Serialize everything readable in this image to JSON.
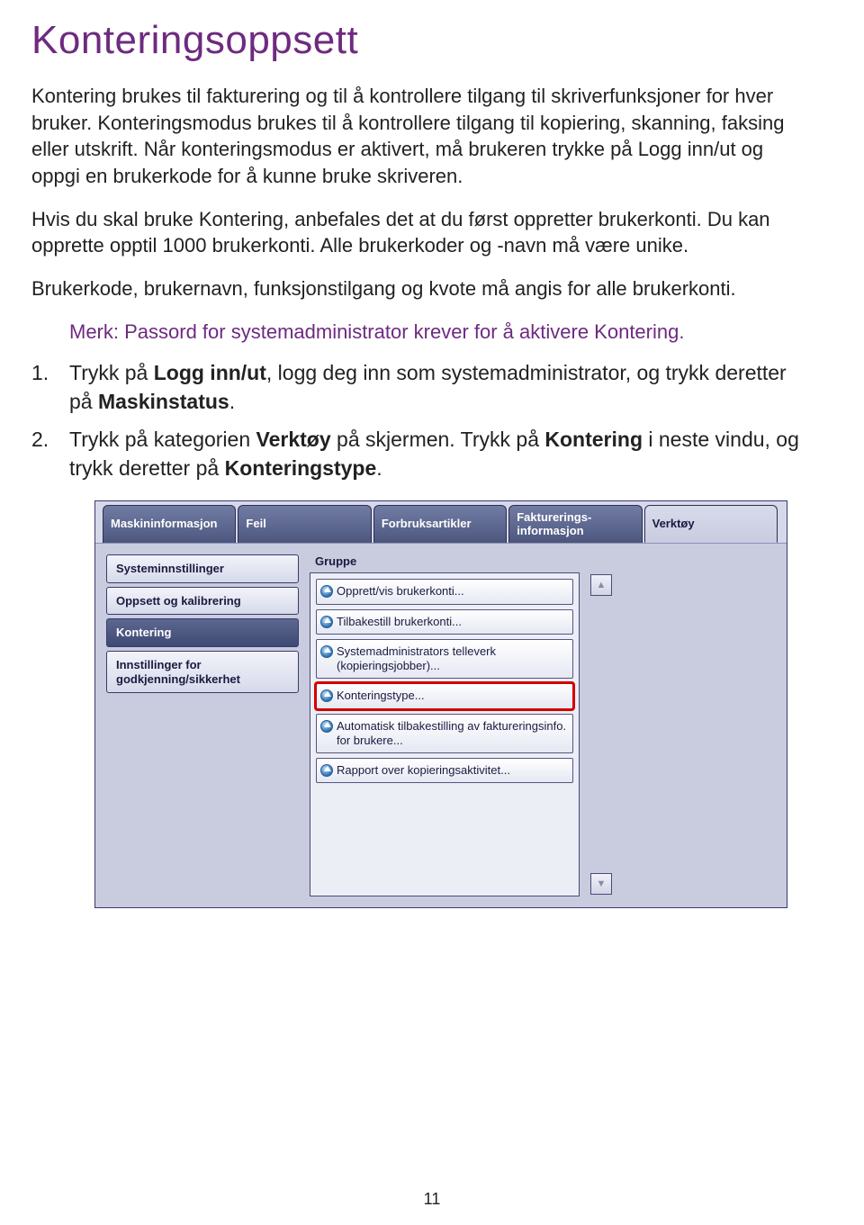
{
  "heading": "Konteringsoppsett",
  "para1": "Kontering brukes til fakturering og til å kontrollere tilgang til skriverfunksjoner for hver bruker. Konteringsmodus brukes til å kontrollere tilgang til kopiering, skanning, faksing eller utskrift. Når konteringsmodus er aktivert, må brukeren trykke på Logg inn/ut og oppgi en brukerkode for å kunne bruke skriveren.",
  "para2": "Hvis du skal bruke Kontering, anbefales det at du først oppretter brukerkonti. Du kan opprette opptil 1000 brukerkonti. Alle brukerkoder og -navn må være unike.",
  "para3": "Brukerkode, brukernavn, funksjonstilgang og kvote må angis for alle brukerkonti.",
  "note": "Merk: Passord for systemadministrator krever for å aktivere Kontering.",
  "step1_num": "1.",
  "step1_a": "Trykk på ",
  "step1_b": "Logg inn/ut",
  "step1_c": ", logg deg inn som systemadministrator, og trykk deretter på ",
  "step1_d": "Maskinstatus",
  "step1_e": ".",
  "step2_num": "2.",
  "step2_a": "Trykk på kategorien ",
  "step2_b": "Verktøy",
  "step2_c": " på skjermen. Trykk på ",
  "step2_d": "Kontering",
  "step2_e": " i neste vindu, og trykk deretter på ",
  "step2_f": "Konteringstype",
  "step2_g": ".",
  "tabs": {
    "t0": "Maskininformasjon",
    "t1": "Feil",
    "t2": "Forbruksartikler",
    "t3": "Fakturerings-\ninformasjon",
    "t4": "Verktøy"
  },
  "sidebar": {
    "s0": "Systeminnstillinger",
    "s1": "Oppsett og kalibrering",
    "s2": "Kontering",
    "s3": "Innstillinger for godkjenning/sikkerhet"
  },
  "groupTitle": "Gruppe",
  "items": {
    "i0": "Opprett/vis brukerkonti...",
    "i1": "Tilbakestill brukerkonti...",
    "i2": "Systemadministrators telleverk (kopieringsjobber)...",
    "i3": "Konteringstype...",
    "i4": "Automatisk tilbakestilling av faktureringsinfo. for brukere...",
    "i5": "Rapport over kopieringsaktivitet..."
  },
  "scrollUp": "▲",
  "scrollDown": "▼",
  "pageNumber": "11"
}
